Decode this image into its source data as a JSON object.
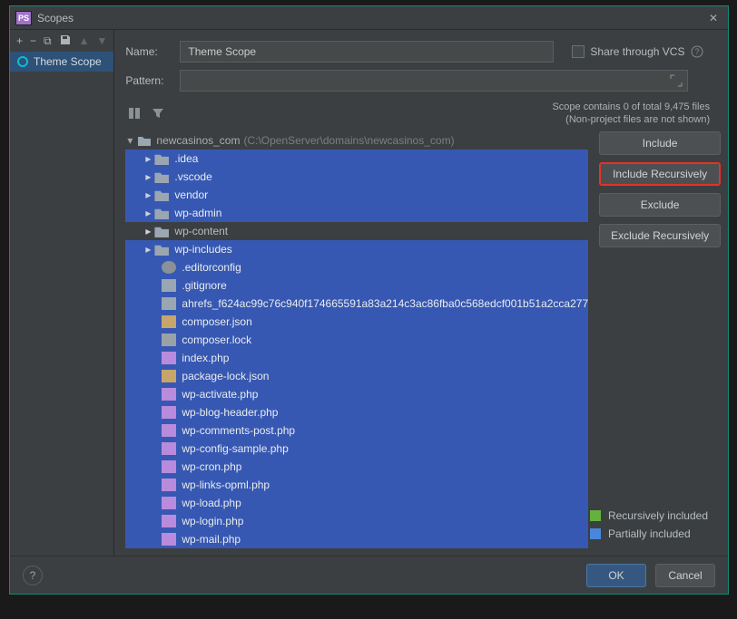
{
  "dialog": {
    "title": "Scopes"
  },
  "sidebar": {
    "toolbar": {
      "add": "+",
      "remove": "−",
      "copy": "⧉",
      "save": "💾",
      "up": "▲",
      "down": "▼"
    },
    "item_label": "Theme Scope"
  },
  "fields": {
    "name_label": "Name:",
    "name_value": "Theme Scope",
    "pattern_label": "Pattern:",
    "pattern_value": "",
    "share_label": "Share through VCS"
  },
  "stats": {
    "line1": "Scope contains 0 of total 9,475 files",
    "line2": "(Non-project files are not shown)"
  },
  "tree": {
    "root_name": "newcasinos_com",
    "root_path": "(C:\\OpenServer\\domains\\newcasinos_com)",
    "items": [
      {
        "kind": "folder",
        "sel": true,
        "label": ".idea"
      },
      {
        "kind": "folder",
        "sel": true,
        "label": ".vscode"
      },
      {
        "kind": "folder",
        "sel": true,
        "label": "vendor"
      },
      {
        "kind": "folder",
        "sel": true,
        "label": "wp-admin"
      },
      {
        "kind": "folder",
        "sel": false,
        "label": "wp-content"
      },
      {
        "kind": "folder",
        "sel": true,
        "label": "wp-includes"
      },
      {
        "kind": "gear",
        "sel": true,
        "label": ".editorconfig",
        "depth": 2
      },
      {
        "kind": "txt",
        "sel": true,
        "label": ".gitignore",
        "depth": 2
      },
      {
        "kind": "txt",
        "sel": true,
        "label": "ahrefs_f624ac99c76c940f174665591a83a214c3ac86fba0c568edcf001b51a2cca277",
        "depth": 2
      },
      {
        "kind": "brace",
        "sel": true,
        "label": "composer.json",
        "depth": 2
      },
      {
        "kind": "lock",
        "sel": true,
        "label": "composer.lock",
        "depth": 2
      },
      {
        "kind": "php",
        "sel": true,
        "label": "index.php",
        "depth": 2
      },
      {
        "kind": "brace",
        "sel": true,
        "label": "package-lock.json",
        "depth": 2
      },
      {
        "kind": "php",
        "sel": true,
        "label": "wp-activate.php",
        "depth": 2
      },
      {
        "kind": "php",
        "sel": true,
        "label": "wp-blog-header.php",
        "depth": 2
      },
      {
        "kind": "php",
        "sel": true,
        "label": "wp-comments-post.php",
        "depth": 2
      },
      {
        "kind": "php",
        "sel": true,
        "label": "wp-config-sample.php",
        "depth": 2
      },
      {
        "kind": "php",
        "sel": true,
        "label": "wp-cron.php",
        "depth": 2
      },
      {
        "kind": "php",
        "sel": true,
        "label": "wp-links-opml.php",
        "depth": 2
      },
      {
        "kind": "php",
        "sel": true,
        "label": "wp-load.php",
        "depth": 2
      },
      {
        "kind": "php",
        "sel": true,
        "label": "wp-login.php",
        "depth": 2
      },
      {
        "kind": "php",
        "sel": true,
        "label": "wp-mail.php",
        "depth": 2
      }
    ]
  },
  "scope_buttons": {
    "include": "Include",
    "include_rec": "Include Recursively",
    "exclude": "Exclude",
    "exclude_rec": "Exclude Recursively"
  },
  "legend": {
    "rec": "Recursively included",
    "part": "Partially included"
  },
  "footer": {
    "ok": "OK",
    "cancel": "Cancel"
  }
}
